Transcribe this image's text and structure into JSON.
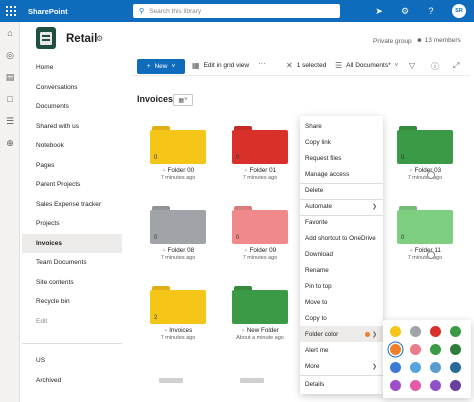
{
  "suite": {
    "app_name": "SharePoint",
    "search_placeholder": "Search this library",
    "avatar_initials": "SR"
  },
  "site": {
    "title": "Retail",
    "privacy": "Private group",
    "members": "13 members"
  },
  "nav": {
    "items": [
      "Home",
      "Conversations",
      "Documents",
      "Shared with us",
      "Notebook",
      "Pages",
      "Parent Projects",
      "Sales Expense tracker",
      "Projects",
      "Invoices",
      "Team Documents",
      "Site contents",
      "Recycle bin",
      "Edit"
    ],
    "lower_items": [
      "US",
      "Archived"
    ]
  },
  "commands": {
    "new": "New",
    "grid": "Edit in grid view",
    "more": "···",
    "selected": "1 selected",
    "view": "All Documents*"
  },
  "library": {
    "title": "Invoices"
  },
  "folders": [
    {
      "name": "Folder 00",
      "time": "7 minutes ago",
      "count": "0",
      "color": "#f5c518"
    },
    {
      "name": "Folder 01",
      "time": "7 minutes ago",
      "count": "0",
      "color": "#d9302c"
    },
    {
      "name": "Folder 03",
      "time": "7 minutes ago",
      "count": "0",
      "color": "#3a9a45"
    },
    {
      "name": "Folder 08",
      "time": "7 minutes ago",
      "count": "0",
      "color": "#a0a4a8"
    },
    {
      "name": "Folder 09",
      "time": "7 minutes ago",
      "count": "0",
      "color": "#f08a8a"
    },
    {
      "name": "Folder 11",
      "time": "7 minutes ago",
      "count": "0",
      "color": "#7fcf83"
    },
    {
      "name": "Invoices",
      "time": "7 minutes ago",
      "count": "2",
      "color": "#f5c518"
    },
    {
      "name": "New Folder",
      "time": "About a minute ago",
      "count": "",
      "color": "#3a9a45"
    }
  ],
  "context_menu": {
    "items": [
      "Share",
      "Copy link",
      "Request files",
      "Manage access",
      "Delete",
      "Automate",
      "Favorite",
      "Add shortcut to OneDrive",
      "Download",
      "Rename",
      "Pin to top",
      "Move to",
      "Copy to",
      "Folder color",
      "Alert me",
      "More",
      "Details"
    ]
  },
  "palette": {
    "colors": [
      "#f5c518",
      "#a0a4a8",
      "#d9302c",
      "#3a9a45",
      "#f07e2a",
      "#e97b8c",
      "#3a9a45",
      "#2f7b3a",
      "#3a7bd5",
      "#55a5dc",
      "#5a9cd1",
      "#2a6b9c",
      "#9c4fc8",
      "#e45ca6",
      "#8e4fc8",
      "#6b3fa0"
    ]
  },
  "colors": {
    "accent": "#0f6cbd"
  }
}
